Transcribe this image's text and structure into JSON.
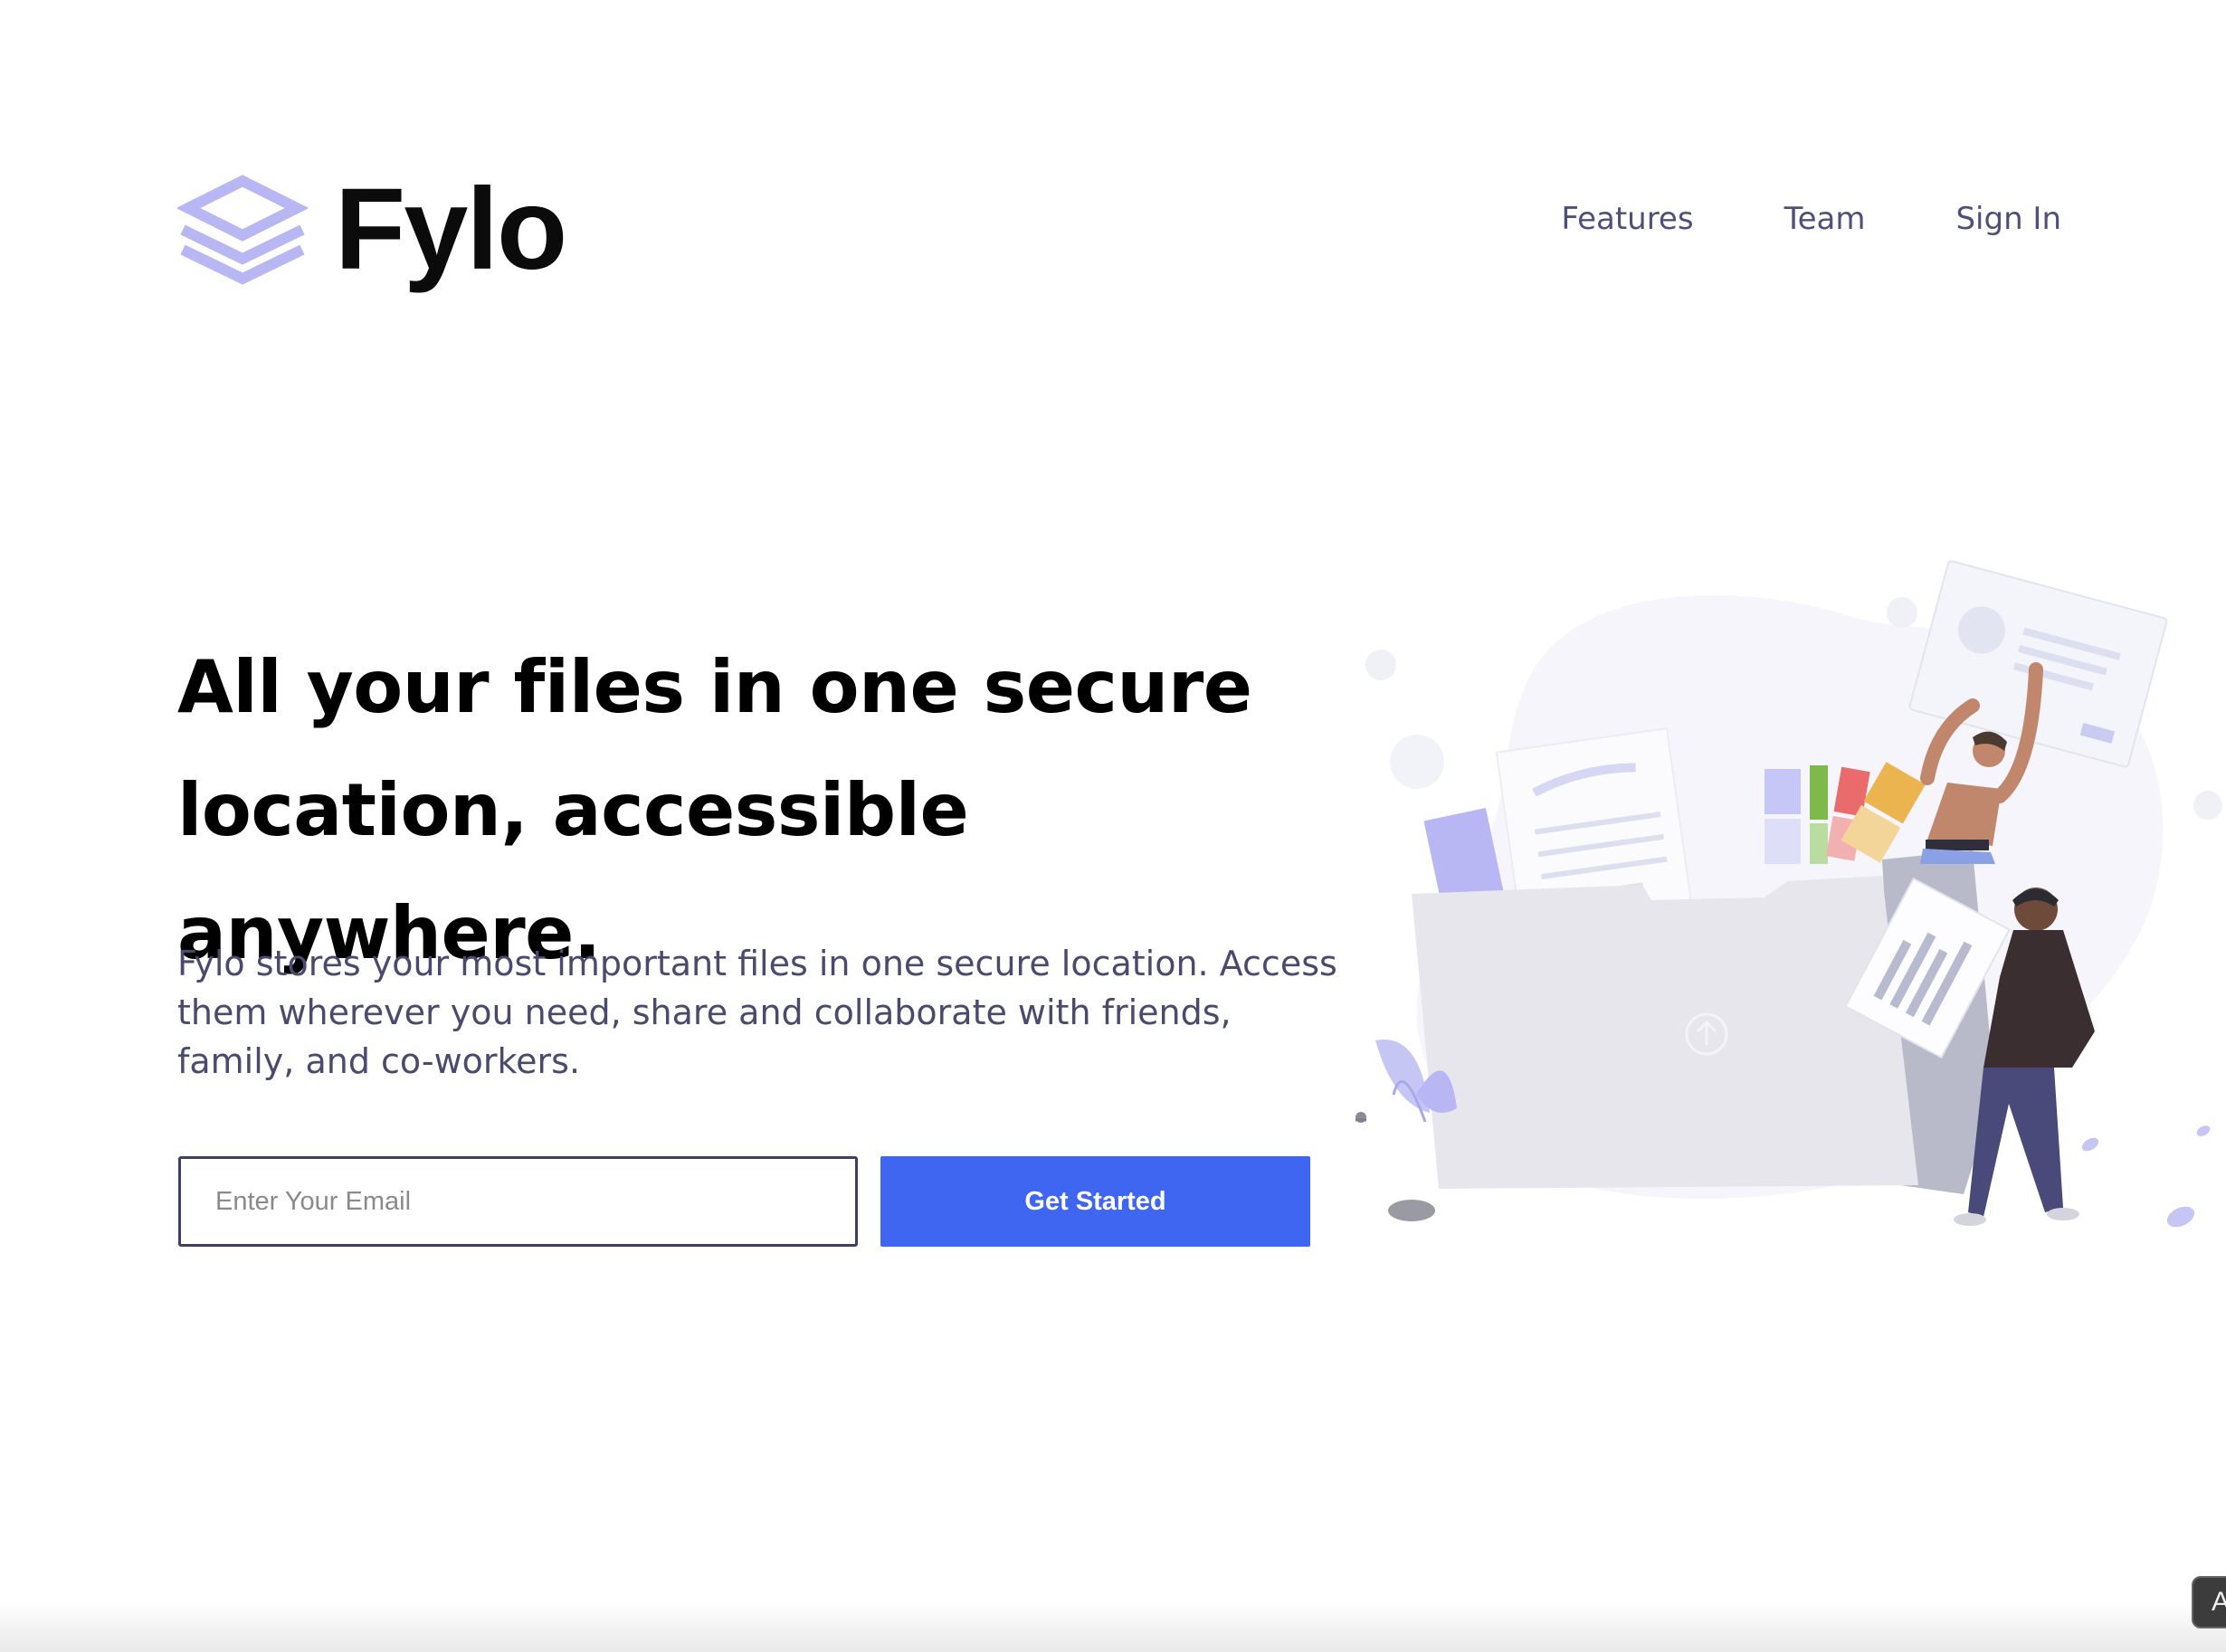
{
  "brand": {
    "name": "Fylo",
    "icon": "stacked-layers-icon",
    "icon_color": "#b8b6f3"
  },
  "nav": {
    "items": [
      {
        "label": "Features"
      },
      {
        "label": "Team"
      },
      {
        "label": "Sign In"
      }
    ]
  },
  "hero": {
    "title": "All your files in one secure location, accessible anywhere.",
    "description": "Fylo stores your most important files in one secure location. Access them wherever you need, share and collaborate with friends, family, and co-workers.",
    "email_placeholder": "Enter Your Email",
    "email_value": "",
    "cta_label": "Get Started",
    "illustration": "folder-with-people-illustration"
  },
  "corner_chip": {
    "label": "A"
  },
  "colors": {
    "accent": "#3f66f0",
    "nav_text": "#4e4f7a",
    "body_text": "#4a4a6e",
    "input_border": "#3e3f66"
  }
}
